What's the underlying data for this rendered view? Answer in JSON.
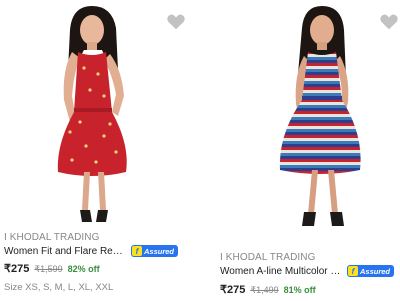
{
  "products": [
    {
      "brand": "I KHODAL TRADING",
      "title": "Women Fit and Flare Red D...",
      "assured_label": "Assured",
      "price": "₹275",
      "mrp": "₹1,599",
      "discount": "82% off",
      "sizes": "Size XS, S, M, L, XL, XXL",
      "dress_color": "#c8232c"
    },
    {
      "brand": "I KHODAL TRADING",
      "title": "Women A-line Multicolor Dr...",
      "assured_label": "Assured",
      "price": "₹275",
      "mrp": "₹1,499",
      "discount": "81% off",
      "dress_color": "#2a3f8f"
    }
  ],
  "icons": {
    "wishlist": "heart-icon",
    "assured": "flipkart-f-icon"
  },
  "colors": {
    "assured_badge": "#2874f0",
    "discount": "#388e3c",
    "wishlist": "#c2c2c2"
  }
}
